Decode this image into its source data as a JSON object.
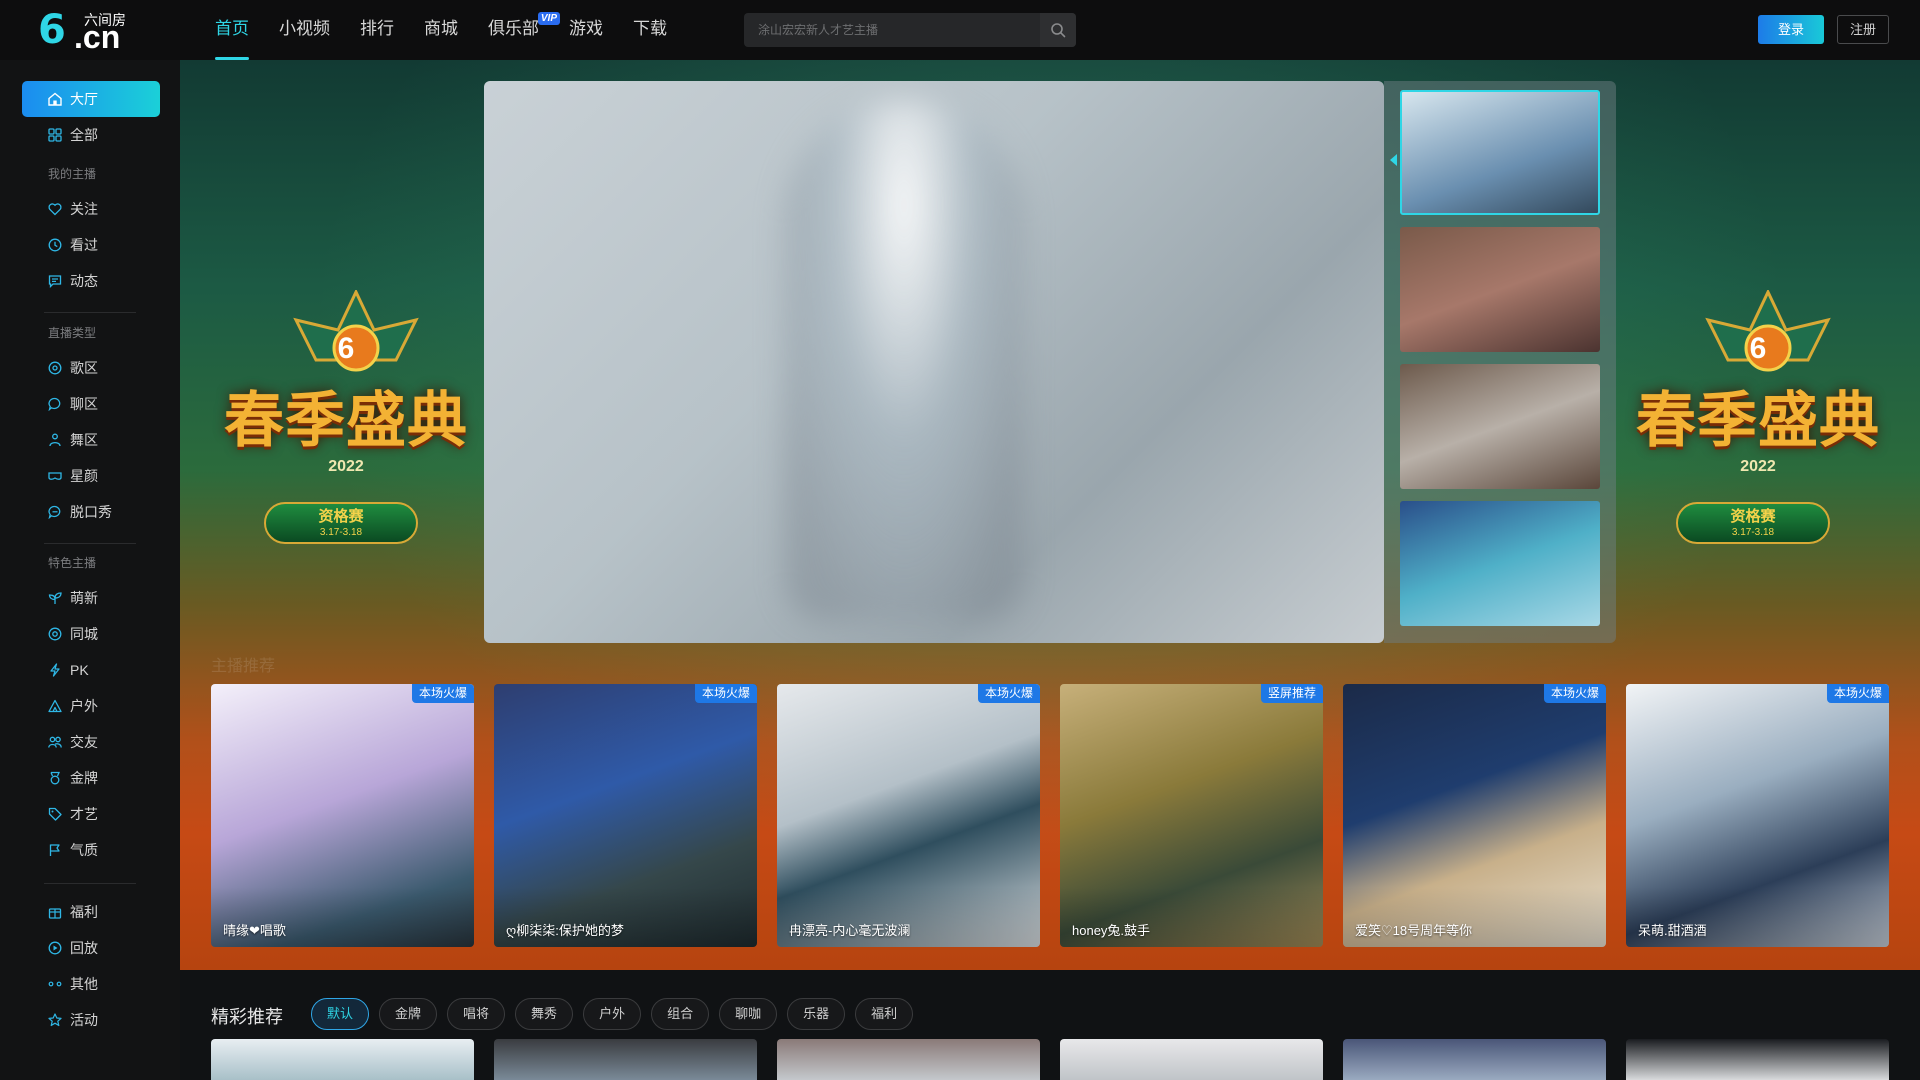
{
  "logo": {
    "mark": "6",
    "suffix": ".cn",
    "cn_name": "六间房"
  },
  "nav": [
    {
      "label": "首页",
      "active": true
    },
    {
      "label": "小视频"
    },
    {
      "label": "排行"
    },
    {
      "label": "商城"
    },
    {
      "label": "俱乐部",
      "badge": "VIP"
    },
    {
      "label": "游戏"
    },
    {
      "label": "下载"
    }
  ],
  "search": {
    "placeholder": "涂山宏宏新人才艺主播",
    "icon": "search-icon"
  },
  "auth": {
    "login": "登录",
    "register": "注册"
  },
  "sidebar": {
    "top": [
      {
        "label": "大厅",
        "icon": "home-icon",
        "active": true
      },
      {
        "label": "全部",
        "icon": "grid-icon"
      }
    ],
    "my_head": "我的主播",
    "my": [
      {
        "label": "关注",
        "icon": "heart-icon"
      },
      {
        "label": "看过",
        "icon": "clock-icon"
      },
      {
        "label": "动态",
        "icon": "message-icon"
      }
    ],
    "type_head": "直播类型",
    "types": [
      {
        "label": "歌区",
        "icon": "music-icon"
      },
      {
        "label": "聊区",
        "icon": "chat-icon"
      },
      {
        "label": "舞区",
        "icon": "dance-icon"
      },
      {
        "label": "星颜",
        "icon": "mask-icon"
      },
      {
        "label": "脱口秀",
        "icon": "mic-icon"
      }
    ],
    "feature_head": "特色主播",
    "features": [
      {
        "label": "萌新",
        "icon": "sprout-icon"
      },
      {
        "label": "同城",
        "icon": "location-icon"
      },
      {
        "label": "PK",
        "icon": "bolt-icon"
      },
      {
        "label": "户外",
        "icon": "mountain-icon"
      },
      {
        "label": "交友",
        "icon": "users-icon"
      },
      {
        "label": "金牌",
        "icon": "medal-icon"
      },
      {
        "label": "才艺",
        "icon": "tag-icon"
      },
      {
        "label": "气质",
        "icon": "flag-icon"
      }
    ],
    "bottom": [
      {
        "label": "福利",
        "icon": "gift-icon"
      },
      {
        "label": "回放",
        "icon": "replay-icon"
      },
      {
        "label": "其他",
        "icon": "more-icon"
      },
      {
        "label": "活动",
        "icon": "star-icon"
      }
    ]
  },
  "event": {
    "title": "春季盛典",
    "year": "2022",
    "stage": "资格赛",
    "dates": "3.17-3.18",
    "emblem": "6"
  },
  "banner": {
    "section_label": "主播推荐"
  },
  "hot_cards": [
    {
      "name": "晴缘❤唱歌",
      "tag": "本场火爆"
    },
    {
      "name": "ღ柳柒柒:保护她的梦",
      "tag": "本场火爆"
    },
    {
      "name": "冉漂亮-内心毫无波澜",
      "tag": "本场火爆"
    },
    {
      "name": "honey兔.鼓手",
      "tag": "竖屏推荐"
    },
    {
      "name": "爱笑♡18号周年等你",
      "tag": "本场火爆"
    },
    {
      "name": "呆萌.甜酒酒",
      "tag": "本场火爆"
    }
  ],
  "recommend": {
    "title": "精彩推荐",
    "filters": [
      "默认",
      "金牌",
      "唱将",
      "舞秀",
      "户外",
      "组合",
      "聊咖",
      "乐器",
      "福利"
    ],
    "active_filter": "默认"
  },
  "colors": {
    "accent": "#2fd6e6",
    "badge": "#1e78e6",
    "login_gradient_start": "#1d7be8"
  }
}
